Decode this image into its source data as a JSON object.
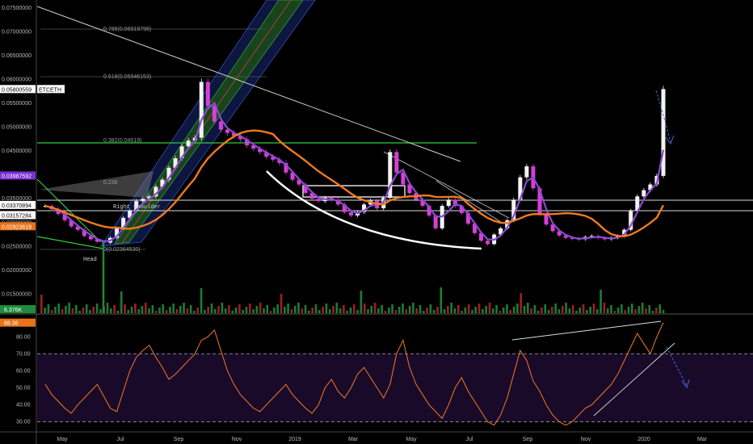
{
  "symbol_tag": "ETCETH",
  "price_tags": [
    {
      "label": "0.05800559",
      "value": 0.05800559,
      "bg": "#ffffff",
      "fg": "#000000"
    },
    {
      "label": "0.03987592",
      "value": 0.03987592,
      "bg": "#7b2fd6",
      "fg": "#ffffff"
    },
    {
      "label": "0.03370894",
      "value": 0.03370894,
      "bg": "#ffffff",
      "fg": "#000000"
    },
    {
      "label": "0.03157284",
      "value": 0.03157284,
      "bg": "#ffffff",
      "fg": "#000000"
    },
    {
      "label": "0.02923619",
      "value": 0.02923619,
      "bg": "#e8731a",
      "fg": "#ffffff"
    }
  ],
  "volume_tag": {
    "label": "6.376K",
    "bg": "#1e8c3a"
  },
  "rsi_tag": {
    "label": "88.36",
    "bg": "#e8731a"
  },
  "annotations": {
    "head": "Head",
    "right_shoulder": "Right Shoulder",
    "fib_786": "0.786(0.06919798)",
    "fib_618": "0.618(0.05946153)",
    "fib_382": "0.382(0.04519)",
    "fib_236": "0.236",
    "fib_0": "0(0.02364530)"
  },
  "colors": {
    "candle_up": "#f2f2f2",
    "candle_down": "#d63fd6",
    "ma_fast": "#8a4ad0",
    "ma_slow": "#f07a1e",
    "rsi_line": "#f07a1e",
    "rsi_band": "#1a0a2a",
    "green_line": "#2ecc40",
    "volume_up": "#1e8c3a",
    "volume_down": "#b22222"
  },
  "chart_data": [
    {
      "type": "line",
      "panel": "price",
      "x_ticks": [
        "May",
        "Jul",
        "Sep",
        "Nov",
        "2019",
        "Mar",
        "May",
        "Jul",
        "Sep",
        "Nov",
        "2020",
        "Mar"
      ],
      "y_ticks": [
        "0.01500000",
        "0.02000000",
        "0.02500000",
        "0.03000000",
        "0.03500000",
        "0.04000000",
        "0.04500000",
        "0.05000000",
        "0.05500000",
        "0.06000000",
        "0.06500000",
        "0.07000000",
        "0.07500000"
      ],
      "ylim": [
        0.011,
        0.076
      ],
      "series": [
        {
          "values": [
            0.0335,
            0.0328,
            0.0318,
            0.0305,
            0.0292,
            0.0285,
            0.0272,
            0.0265,
            0.026,
            0.0258,
            0.0268,
            0.0288,
            0.031,
            0.0325,
            0.0345,
            0.035,
            0.0355,
            0.0375,
            0.039,
            0.0415,
            0.0435,
            0.046,
            0.0472,
            0.0478,
            0.0595,
            0.0545,
            0.0512,
            0.0495,
            0.0488,
            0.0482,
            0.0475,
            0.0462,
            0.0455,
            0.0448,
            0.0438,
            0.0432,
            0.0425,
            0.0405,
            0.039,
            0.038,
            0.0362,
            0.035,
            0.0345,
            0.0352,
            0.0348,
            0.0338,
            0.0322,
            0.0315,
            0.0322,
            0.0338,
            0.0346,
            0.033,
            0.0352,
            0.0448,
            0.0405,
            0.038,
            0.0362,
            0.0348,
            0.0335,
            0.0315,
            0.0288,
            0.0335,
            0.0348,
            0.0335,
            0.032,
            0.0298,
            0.0278,
            0.0262,
            0.0255,
            0.0275,
            0.0288,
            0.0305,
            0.0348,
            0.0395,
            0.0418,
            0.0372,
            0.0318,
            0.0296,
            0.0282,
            0.0273,
            0.0268,
            0.0266,
            0.0265,
            0.027,
            0.0272,
            0.0268,
            0.0265,
            0.0268,
            0.0272,
            0.0285,
            0.0325,
            0.0355,
            0.0368,
            0.038,
            0.0398,
            0.058
          ]
        }
      ]
    },
    {
      "type": "bar",
      "panel": "volume"
    },
    {
      "type": "line",
      "panel": "rsi",
      "y_ticks": [
        "30.00",
        "40.00",
        "50.00",
        "60.00",
        "70.00",
        "80.00"
      ],
      "ylim": [
        25,
        92
      ],
      "series": [
        {
          "values": [
            52,
            46,
            42,
            38,
            35,
            40,
            44,
            48,
            52,
            45,
            38,
            36,
            48,
            60,
            68,
            72,
            75,
            68,
            62,
            55,
            58,
            62,
            66,
            70,
            78,
            80,
            84,
            72,
            60,
            52,
            46,
            42,
            38,
            36,
            40,
            44,
            48,
            52,
            46,
            42,
            38,
            35,
            40,
            50,
            55,
            48,
            44,
            50,
            58,
            62,
            56,
            50,
            44,
            52,
            70,
            78,
            62,
            52,
            46,
            40,
            36,
            32,
            40,
            50,
            56,
            48,
            42,
            36,
            30,
            28,
            34,
            44,
            58,
            72,
            66,
            54,
            48,
            40,
            34,
            30,
            28,
            30,
            34,
            38,
            40,
            44,
            48,
            52,
            58,
            66,
            74,
            82,
            76,
            70,
            80,
            88.36
          ]
        }
      ]
    }
  ]
}
